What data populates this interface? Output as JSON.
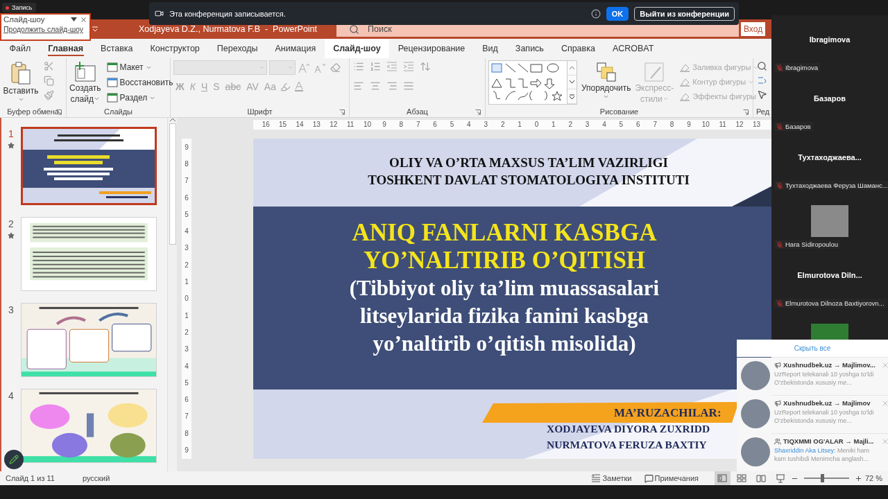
{
  "recording_badge": {
    "label": "Запись"
  },
  "slideshow_popup": {
    "title": "Слайд-шоу",
    "link": "Продолжить слайд-шоу"
  },
  "banner": {
    "message": "Эта конференция записывается.",
    "buttons": [
      {
        "label": "OK",
        "kind": "primary"
      },
      {
        "label": "Выйти из конференции",
        "kind": "outline"
      }
    ]
  },
  "window": {
    "title": "Xodjayeva D.Z., Nurmatova F.B  -  PowerPoint",
    "search": {
      "placeholder": "Поиск"
    },
    "sign_in": "Вход"
  },
  "tabs": [
    {
      "label": "Файл",
      "selected": false,
      "hovered": false
    },
    {
      "label": "Главная",
      "selected": true,
      "hovered": false
    },
    {
      "label": "Вставка",
      "selected": false,
      "hovered": false
    },
    {
      "label": "Конструктор",
      "selected": false,
      "hovered": false
    },
    {
      "label": "Переходы",
      "selected": false,
      "hovered": false
    },
    {
      "label": "Анимация",
      "selected": false,
      "hovered": false
    },
    {
      "label": "Слайд-шоу",
      "selected": false,
      "hovered": true
    },
    {
      "label": "Рецензирование",
      "selected": false,
      "hovered": false
    },
    {
      "label": "Вид",
      "selected": false,
      "hovered": false
    },
    {
      "label": "Запись",
      "selected": false,
      "hovered": false
    },
    {
      "label": "Справка",
      "selected": false,
      "hovered": false
    },
    {
      "label": "ACROBAT",
      "selected": false,
      "hovered": false
    }
  ],
  "ribbon": {
    "groups": [
      {
        "kind": "clipboard",
        "label": "Буфер обмена",
        "paste": "Вставить"
      },
      {
        "kind": "slides",
        "label": "Слайды",
        "new_slide": "Создать слайд",
        "commands": [
          {
            "label": "Макет",
            "dropdown": true
          },
          {
            "label": "Восстановить",
            "dropdown": false
          },
          {
            "label": "Раздел",
            "dropdown": true
          }
        ]
      },
      {
        "kind": "font",
        "label": "Шрифт",
        "disabled": true,
        "formats": [
          "Ж",
          "К",
          "Ч",
          "S",
          "abc",
          "AV",
          "Aa"
        ]
      },
      {
        "kind": "paragraph",
        "label": "Абзац"
      },
      {
        "kind": "drawing",
        "label": "Рисование",
        "arrange": "Упорядочить",
        "quick_styles": {
          "label": "Экспресс-стили",
          "disabled": true
        },
        "shape_commands": [
          {
            "label": "Заливка фигуры",
            "disabled": true
          },
          {
            "label": "Контур фигуры",
            "disabled": true
          },
          {
            "label": "Эффекты фигуры",
            "disabled": true
          }
        ]
      },
      {
        "kind": "editing",
        "label": "Ред"
      }
    ]
  },
  "thumbnails": [
    {
      "number": "1",
      "selected": true,
      "starred": true,
      "kind": "title"
    },
    {
      "number": "2",
      "selected": false,
      "starred": true,
      "kind": "text"
    },
    {
      "number": "3",
      "selected": false,
      "starred": false,
      "kind": "diagram"
    },
    {
      "number": "4",
      "selected": false,
      "starred": false,
      "kind": "circles"
    }
  ],
  "ruler": {
    "horizontal": [
      "16",
      "15",
      "14",
      "13",
      "12",
      "11",
      "10",
      "9",
      "8",
      "7",
      "6",
      "5",
      "4",
      "3",
      "2",
      "1",
      "0",
      "1",
      "2",
      "3",
      "4",
      "5",
      "6",
      "7",
      "8",
      "9",
      "10",
      "11",
      "12",
      "13"
    ],
    "vertical": [
      "9",
      "8",
      "7",
      "6",
      "5",
      "4",
      "3",
      "2",
      "1",
      "0",
      "1",
      "2",
      "3",
      "4",
      "5",
      "6",
      "7",
      "8",
      "9"
    ]
  },
  "slide": {
    "header": [
      "OLIY VA O’RTA MAXSUS TA’LIM VAZIRLIGI",
      "TOSHKENT DAVLAT STOMATOLOGIYA INSTITUTI"
    ],
    "title": [
      "ANIQ FANLARNI KASBGA",
      "YO’NALTIRIB O’QITISH"
    ],
    "subtitle": [
      "(Tibbiyot oliy ta’lim muassasalari",
      "litseylarida fizika fanini kasbga",
      "yo’naltirib o’qitish misolida)"
    ],
    "speakers_label": "MA’RUZACHILAR:",
    "speakers": [
      "XODJAYEVA DIYORA ZUXRIDD",
      "NURMATOVA FERUZA BAXTIY"
    ]
  },
  "status_bar": {
    "slide_info": "Слайд 1 из 11",
    "language": "русский",
    "notes": "Заметки",
    "comments": "Примечания",
    "views": [
      {
        "selected": true
      },
      {
        "selected": false
      },
      {
        "selected": false
      }
    ],
    "zoom": {
      "level": 0.4,
      "reading": "72 %"
    }
  },
  "participants": {
    "tiles": [
      {
        "kind": "name",
        "title": "Ibragimova",
        "label": "Ibragimova",
        "muted": true
      },
      {
        "kind": "name",
        "title": "Базаров",
        "label": "Базаров",
        "muted": true
      },
      {
        "kind": "name",
        "title": "Тухтаходжаева...",
        "label": "Тухтаходжаева Феруза Шаманс...",
        "muted": true
      },
      {
        "kind": "photo",
        "label": "Hara Sidiropoulou",
        "muted": true
      },
      {
        "kind": "name",
        "title": "Elmurotova  Diln...",
        "label": "Elmurotova Dilnoza Baxtiyorovn...",
        "muted": true
      },
      {
        "kind": "video"
      }
    ],
    "hide_all": "Скрыть все"
  },
  "notifications": [
    {
      "kind": "channel",
      "title": "Xushnudbek.uz → Majlimov...",
      "text": "UzReport telekanali 10 yoshga to'ldi  O'zbekistonda xususiy me..."
    },
    {
      "kind": "channel",
      "title": "Xushnudbek.uz → Majlimov",
      "text": "UzReport telekanali 10 yoshga to'ldi  O'zbekistonda xususiy me..."
    },
    {
      "kind": "group",
      "title": "TIQXMMI OG'ALAR → Majli...",
      "sender": "Shaxriddin Aka Litsey:",
      "text": "Meniki ham kam tushibdi  Menimcha anglash..."
    }
  ]
}
